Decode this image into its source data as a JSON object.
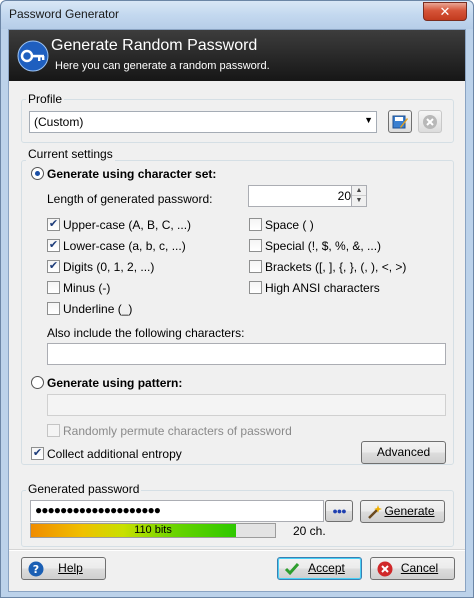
{
  "window": {
    "title": "Password Generator",
    "close_glyph": "✕"
  },
  "banner": {
    "title": "Generate Random Password",
    "subtitle": "Here you can generate a random password.",
    "icon": "key-icon"
  },
  "profile": {
    "group_label": "Profile",
    "selected": "(Custom)",
    "arrow": "▼",
    "save_icon": "save-profile-icon",
    "delete_icon": "delete-profile-icon"
  },
  "settings": {
    "group_label": "Current settings",
    "charset_radio_label": "Generate using character set:",
    "charset_selected": true,
    "length_label": "Length of generated password:",
    "length_value": "20",
    "options": {
      "upper": {
        "label": "Upper-case (A, B, C, ...)",
        "checked": true
      },
      "lower": {
        "label": "Lower-case (a, b, c, ...)",
        "checked": true
      },
      "digits": {
        "label": "Digits (0, 1, 2, ...)",
        "checked": true
      },
      "minus": {
        "label": "Minus (-)",
        "checked": false
      },
      "underline": {
        "label": "Underline (_)",
        "checked": false
      },
      "space": {
        "label": "Space ( )",
        "checked": false
      },
      "special": {
        "label": "Special (!, $, %, &, ...)",
        "checked": false
      },
      "brackets": {
        "label": "Brackets ([, ], {, }, (, ), <, >)",
        "checked": false
      },
      "high_ansi": {
        "label": "High ANSI characters",
        "checked": false
      }
    },
    "also_include_label": "Also include the following characters:",
    "also_include_value": "",
    "pattern_radio_label": "Generate using pattern:",
    "pattern_value": "",
    "permute_label": "Randomly permute characters of password",
    "entropy_label": "Collect additional entropy",
    "entropy_checked": true,
    "advanced_button": "Advanced"
  },
  "generated": {
    "group_label": "Generated password",
    "password_mask": "●●●●●●●●●●●●●●●●●●●●",
    "show_button": "●●●",
    "generate_button": "Generate",
    "strength_text": "110 bits",
    "strength_fraction": 0.84,
    "length_text": "20 ch."
  },
  "footer": {
    "help_button": "Help",
    "accept_button": "Accept",
    "cancel_button": "Cancel"
  },
  "colors": {
    "banner": "#161616",
    "progress_start": "#f08c00",
    "progress_end": "#2ec800",
    "help": "#1a5fb4",
    "accept": "#2e9e2e",
    "cancel": "#d0282a"
  }
}
